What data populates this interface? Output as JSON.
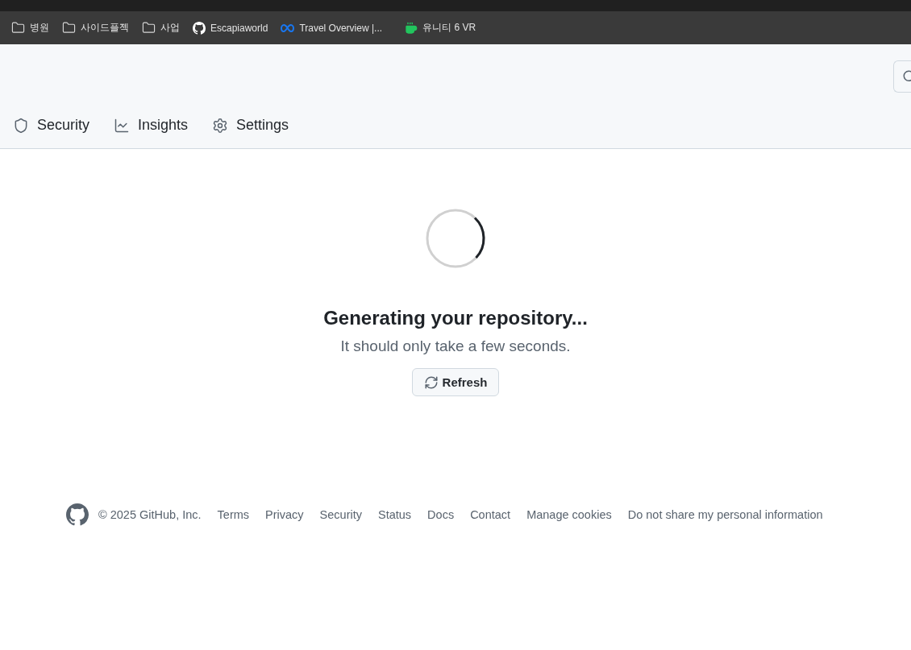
{
  "bookmarks": [
    {
      "kind": "folder",
      "label": "병원"
    },
    {
      "kind": "folder",
      "label": "사이드플젝"
    },
    {
      "kind": "folder",
      "label": "사업"
    },
    {
      "kind": "github",
      "label": "Escapiaworld"
    },
    {
      "kind": "meta",
      "label": "Travel Overview |..."
    },
    {
      "kind": "cup",
      "label": "유니티 6 VR"
    }
  ],
  "tabs": [
    {
      "kind": "shield",
      "label": "Security"
    },
    {
      "kind": "graph",
      "label": "Insights"
    },
    {
      "kind": "gear",
      "label": "Settings"
    }
  ],
  "status": {
    "title": "Generating your repository...",
    "subtitle": "It should only take a few seconds.",
    "button": "Refresh"
  },
  "footer": {
    "copyright": "© 2025 GitHub, Inc.",
    "links": [
      "Terms",
      "Privacy",
      "Security",
      "Status",
      "Docs",
      "Contact",
      "Manage cookies",
      "Do not share my personal information"
    ]
  }
}
